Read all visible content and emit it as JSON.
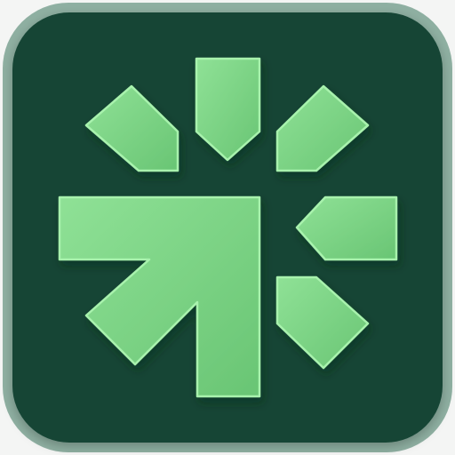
{
  "app_icon": {
    "icon_name": "cursor-click-burst-icon",
    "colors": {
      "page_background": "#f4f5f4",
      "tile_background": "#154535",
      "tile_border": "#8fb0a2",
      "glyph_fill_light": "#8fe196",
      "glyph_fill_dark": "#69c574",
      "glyph_stroke": "#a8f2ad",
      "glyph_shadow": "#0a2a1f"
    },
    "parts": [
      "arrow",
      "ray-top",
      "ray-top-left",
      "ray-top-right",
      "ray-right",
      "ray-bottom-right"
    ]
  }
}
